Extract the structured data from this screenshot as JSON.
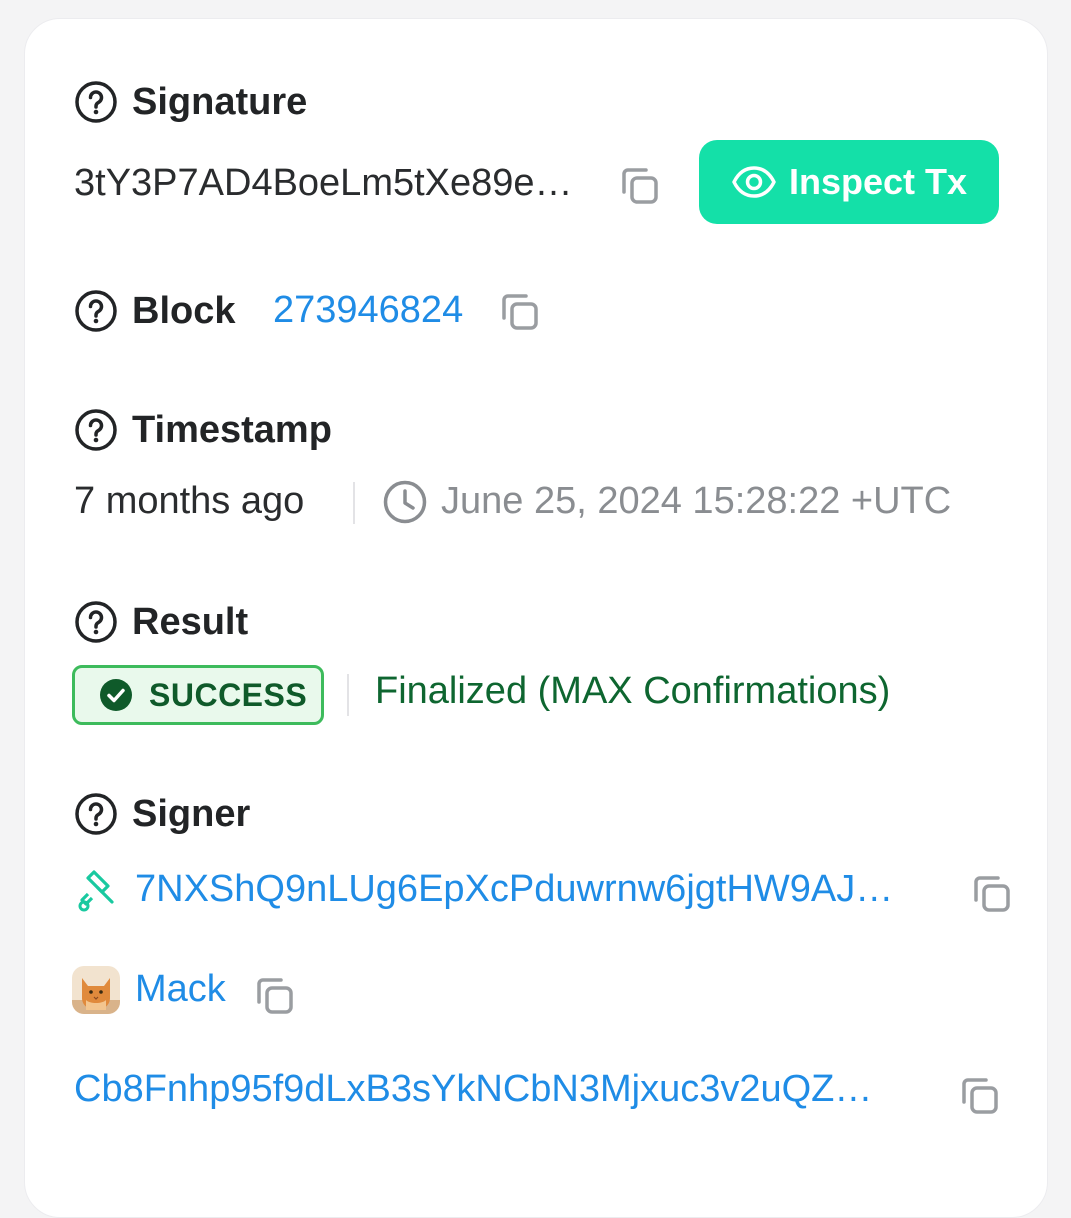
{
  "signature": {
    "label": "Signature",
    "value": "3tY3P7AD4BoeLm5tXe89e…",
    "inspect_label": "Inspect Tx"
  },
  "block": {
    "label": "Block",
    "value": "273946824"
  },
  "timestamp": {
    "label": "Timestamp",
    "relative": "7 months ago",
    "absolute": "June 25, 2024 15:28:22 +UTC"
  },
  "result": {
    "label": "Result",
    "status": "SUCCESS",
    "confirmation": "Finalized (MAX Confirmations)"
  },
  "signer": {
    "label": "Signer",
    "address": "7NXShQ9nLUg6EpXcPduwrnw6jgtHW9AJ…",
    "name": "Mack",
    "second_address": "Cb8Fnhp95f9dLxB3sYkNCbN3Mjxuc3v2uQZ…"
  },
  "colors": {
    "accent": "#14e0a8",
    "link": "#1f8ce6",
    "success": "#3dbb5c"
  }
}
